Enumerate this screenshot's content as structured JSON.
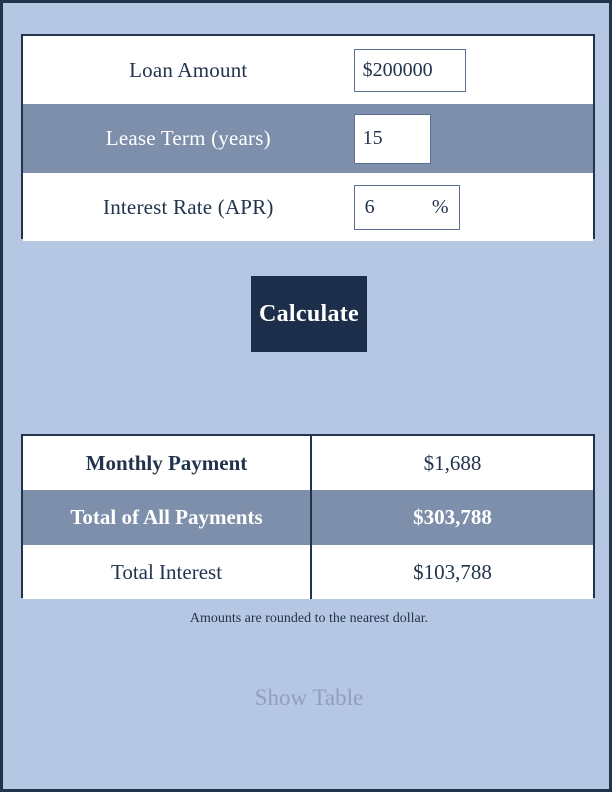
{
  "theme": {
    "page_background": "#b6c7e4",
    "border": "#22334e",
    "row_highlight": "#7d8fab",
    "button_background": "#1c2e4a",
    "button_text": "#ffffff",
    "text": "#22334e",
    "muted_link": "#8fa0bd"
  },
  "inputs": {
    "rows": [
      {
        "label": "Loan Amount",
        "value": "$200000",
        "placeholder": "$200000",
        "suffix": "",
        "highlighted": false
      },
      {
        "label": "Lease Term (years)",
        "value": "15",
        "placeholder": "15",
        "suffix": "",
        "highlighted": true
      },
      {
        "label": "Interest Rate (APR)",
        "value": "6",
        "placeholder": "6",
        "suffix": "%",
        "highlighted": false
      }
    ]
  },
  "actions": {
    "calculate_label": "Calculate",
    "show_table_label": "Show Table"
  },
  "results": {
    "rows": [
      {
        "label": "Monthly Payment",
        "value": "$1,688",
        "highlighted": false
      },
      {
        "label": "Total of All Payments",
        "value": "$303,788",
        "highlighted": true
      },
      {
        "label": "Total Interest",
        "value": "$103,788",
        "highlighted": false
      }
    ]
  },
  "footer": {
    "rounding_note": "Amounts are rounded to the nearest dollar."
  }
}
